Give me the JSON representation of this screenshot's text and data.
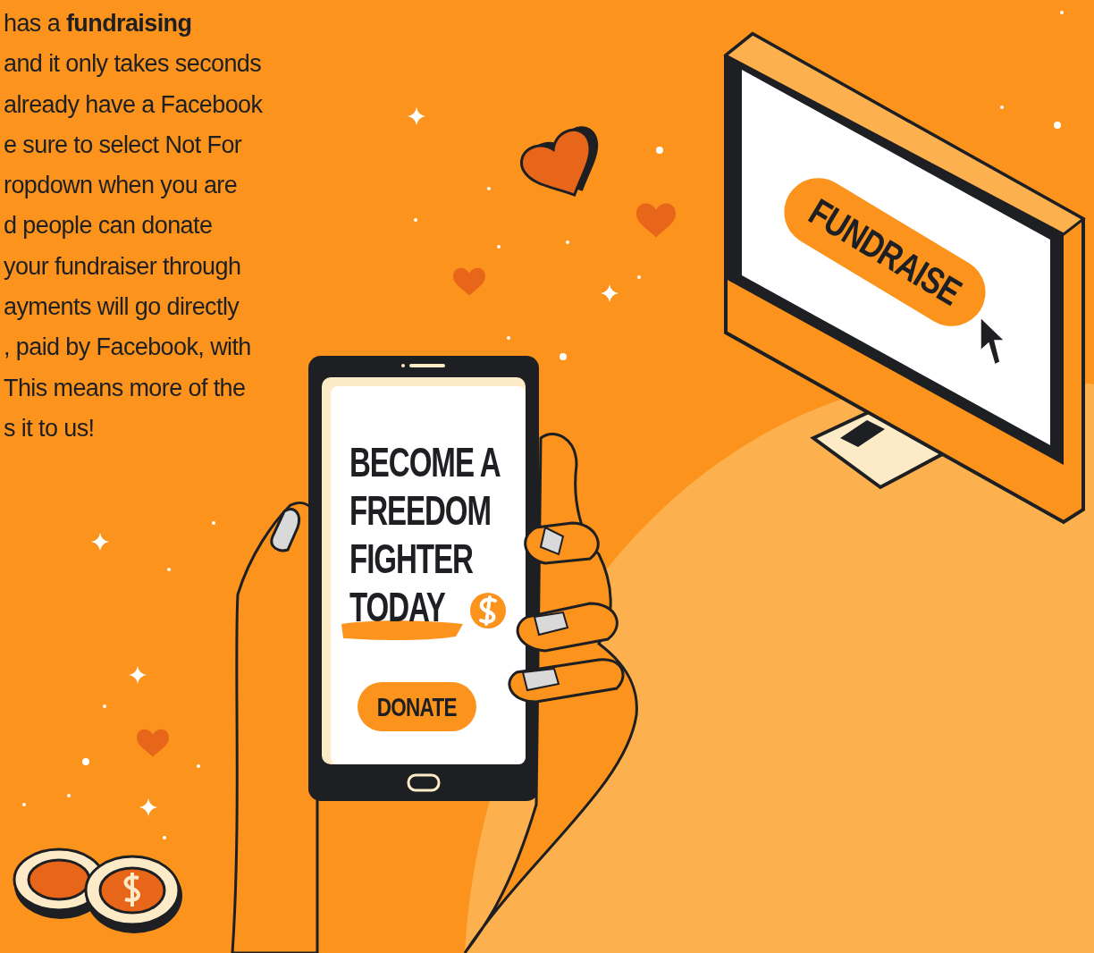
{
  "intro": {
    "lines": [
      "has a **fundraising**",
      "and it only takes seconds",
      "already have a Facebook",
      "e sure to select Not For",
      "ropdown when you are",
      "d people can donate",
      "your fundraiser through",
      "ayments will go directly",
      ", paid by Facebook, with",
      "This means more of the",
      "s it to us!"
    ]
  },
  "phone": {
    "headline_lines": [
      "BECOME A",
      "FREEDOM",
      "FIGHTER",
      "TODAY"
    ],
    "button": "DONATE"
  },
  "monitor": {
    "button": "FUNDRAISE"
  }
}
